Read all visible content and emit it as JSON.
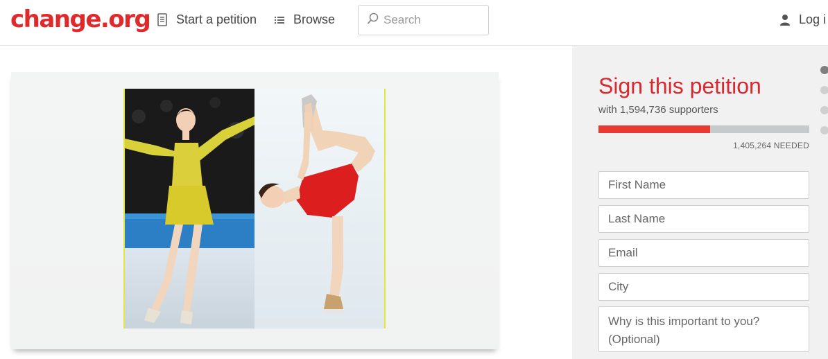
{
  "header": {
    "logo": "change.org",
    "nav": [
      {
        "label": "Start a petition",
        "icon": "document-icon"
      },
      {
        "label": "Browse",
        "icon": "list-icon"
      }
    ],
    "search": {
      "placeholder": "Search",
      "icon": "search-icon"
    },
    "login": {
      "label": "Log i",
      "icon": "user-icon"
    }
  },
  "media": {
    "images": [
      {
        "description_icon": "figure-skater-yellow-photo"
      },
      {
        "description_icon": "figure-skater-red-photo"
      }
    ],
    "border_color": "#e4e63a"
  },
  "petition": {
    "title": "Sign this petition",
    "supporters_text": "with 1,594,736 supporters",
    "progress_fraction": 0.53,
    "needed_text": "1,405,264 NEEDED",
    "fields": {
      "first_name": "First Name",
      "last_name": "Last Name",
      "email": "Email",
      "city": "City",
      "why": "Why is this important to you? (Optional)"
    },
    "accent_color": "#d9282f",
    "progress_color": "#e63a32"
  },
  "side_nav": {
    "dots": 4,
    "active_index": 0
  }
}
